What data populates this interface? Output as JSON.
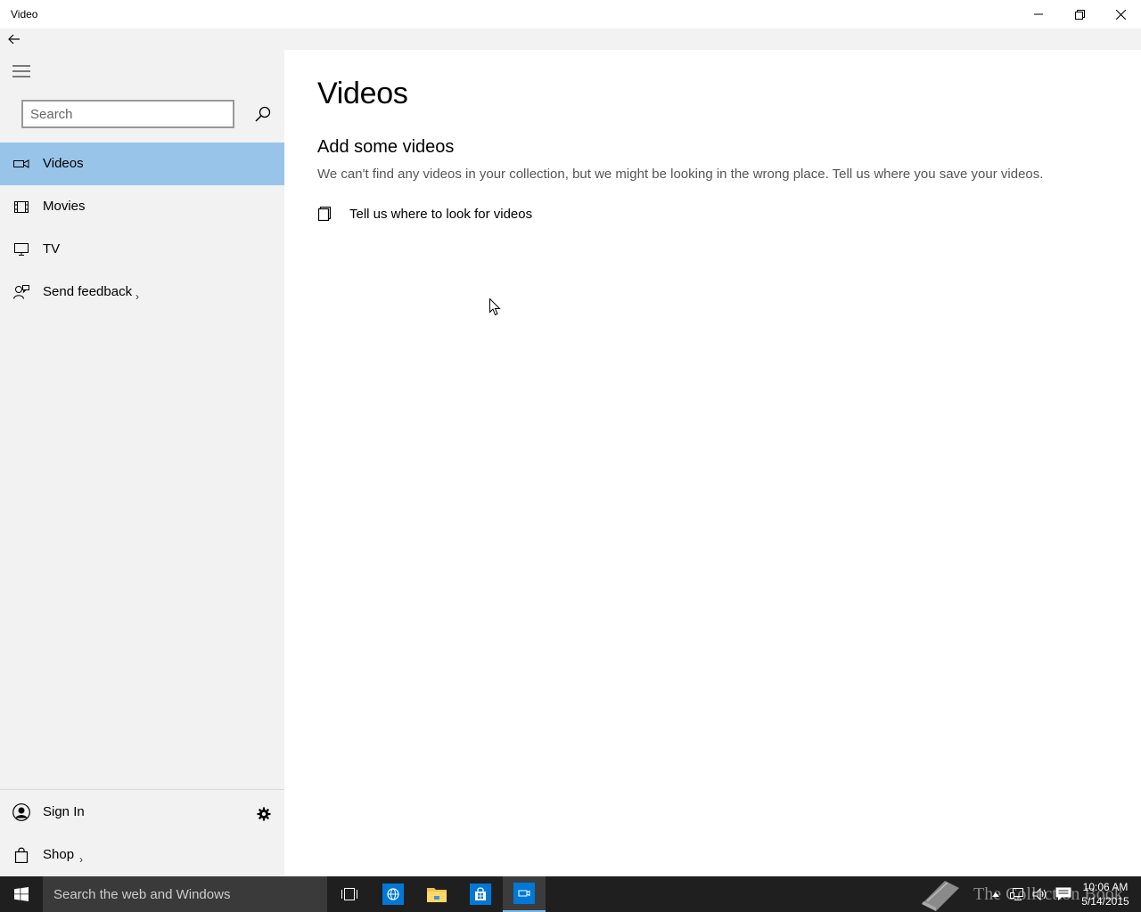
{
  "window": {
    "title": "Video"
  },
  "sidebar": {
    "search_placeholder": "Search",
    "items": [
      {
        "label": "Videos",
        "icon": "video-camera-icon",
        "selected": true
      },
      {
        "label": "Movies",
        "icon": "film-icon",
        "selected": false
      },
      {
        "label": "TV",
        "icon": "monitor-icon",
        "selected": false
      },
      {
        "label": "Send feedback",
        "icon": "feedback-icon",
        "selected": false,
        "has_chevron": true
      }
    ],
    "footer": [
      {
        "label": "Sign In",
        "icon": "person-icon"
      },
      {
        "label": "Shop",
        "icon": "shopping-bag-icon",
        "has_chevron": true
      }
    ]
  },
  "main": {
    "title": "Videos",
    "section_title": "Add some videos",
    "section_desc": "We can't find any videos in your collection, but we might be looking in the wrong place. Tell us where you save your videos.",
    "action_label": "Tell us where to look for videos"
  },
  "taskbar": {
    "search_placeholder": "Search the web and Windows",
    "watermark": "The Collection Book",
    "time": "10:06 AM",
    "date": "5/14/2015"
  },
  "colors": {
    "selected_nav": "#99c4ea",
    "sidebar_bg": "#f2f2f2",
    "taskbar_bg": "#1f1f1f",
    "accent": "#0078d7"
  }
}
